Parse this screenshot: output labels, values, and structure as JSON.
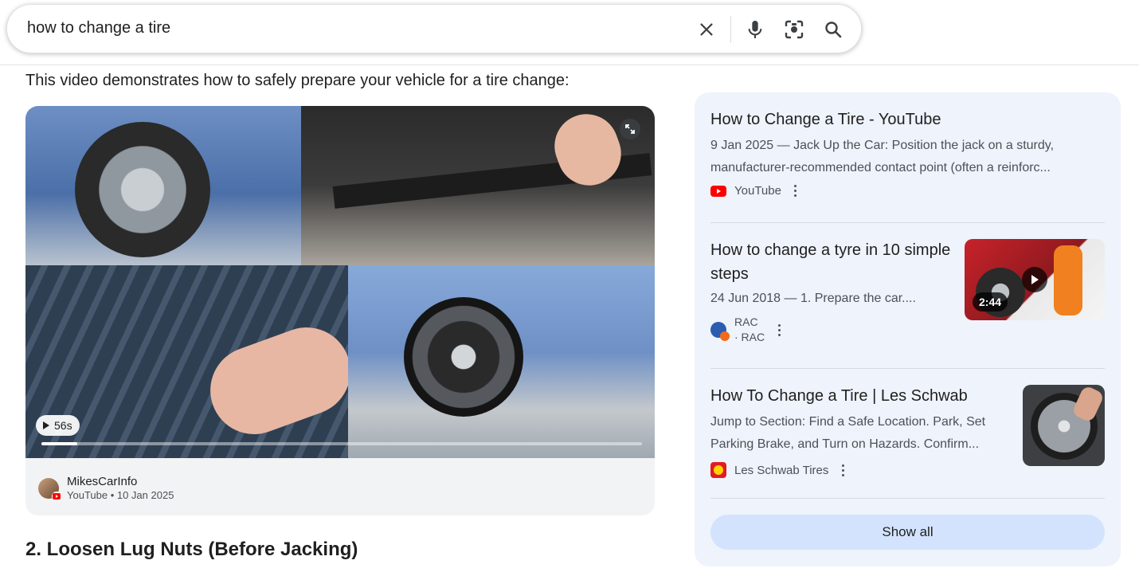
{
  "search": {
    "query": "how to change a tire"
  },
  "intro_text": "This video demonstrates how to safely prepare your vehicle for a tire change:",
  "video": {
    "duration": "56s",
    "progress_fraction": 0.06,
    "channel_name": "MikesCarInfo",
    "channel_meta": "YouTube • 10 Jan 2025"
  },
  "step_heading": "2. Loosen Lug Nuts (Before Jacking)",
  "results": [
    {
      "title": "How to Change a Tire - YouTube",
      "snippet_line1": "9 Jan 2025 — Jack Up the Car: Position the jack on a sturdy,",
      "snippet_line2": "manufacturer-recommended contact point (often a reinforc...",
      "source": "YouTube",
      "icon": "youtube-icon"
    },
    {
      "title_line1": "How to change a tyre in 10 simple",
      "title_line2": "steps",
      "snippet": "24 Jun 2018 — 1. Prepare the car....",
      "source": "RAC",
      "source_sub": "· RAC",
      "thumb_duration": "2:44",
      "icon": "rac-icon"
    },
    {
      "title": "How To Change a Tire | Les Schwab",
      "snippet_line1": "Jump to Section: Find a Safe Location. Park, Set",
      "snippet_line2": "Parking Brake, and Turn on Hazards. Confirm...",
      "source": "Les Schwab Tires",
      "icon": "les-schwab-icon"
    }
  ],
  "show_all_label": "Show all",
  "colors": {
    "panel_bg": "#eef3fc",
    "show_all_bg": "#d3e3fd",
    "youtube_red": "#ff0000"
  }
}
